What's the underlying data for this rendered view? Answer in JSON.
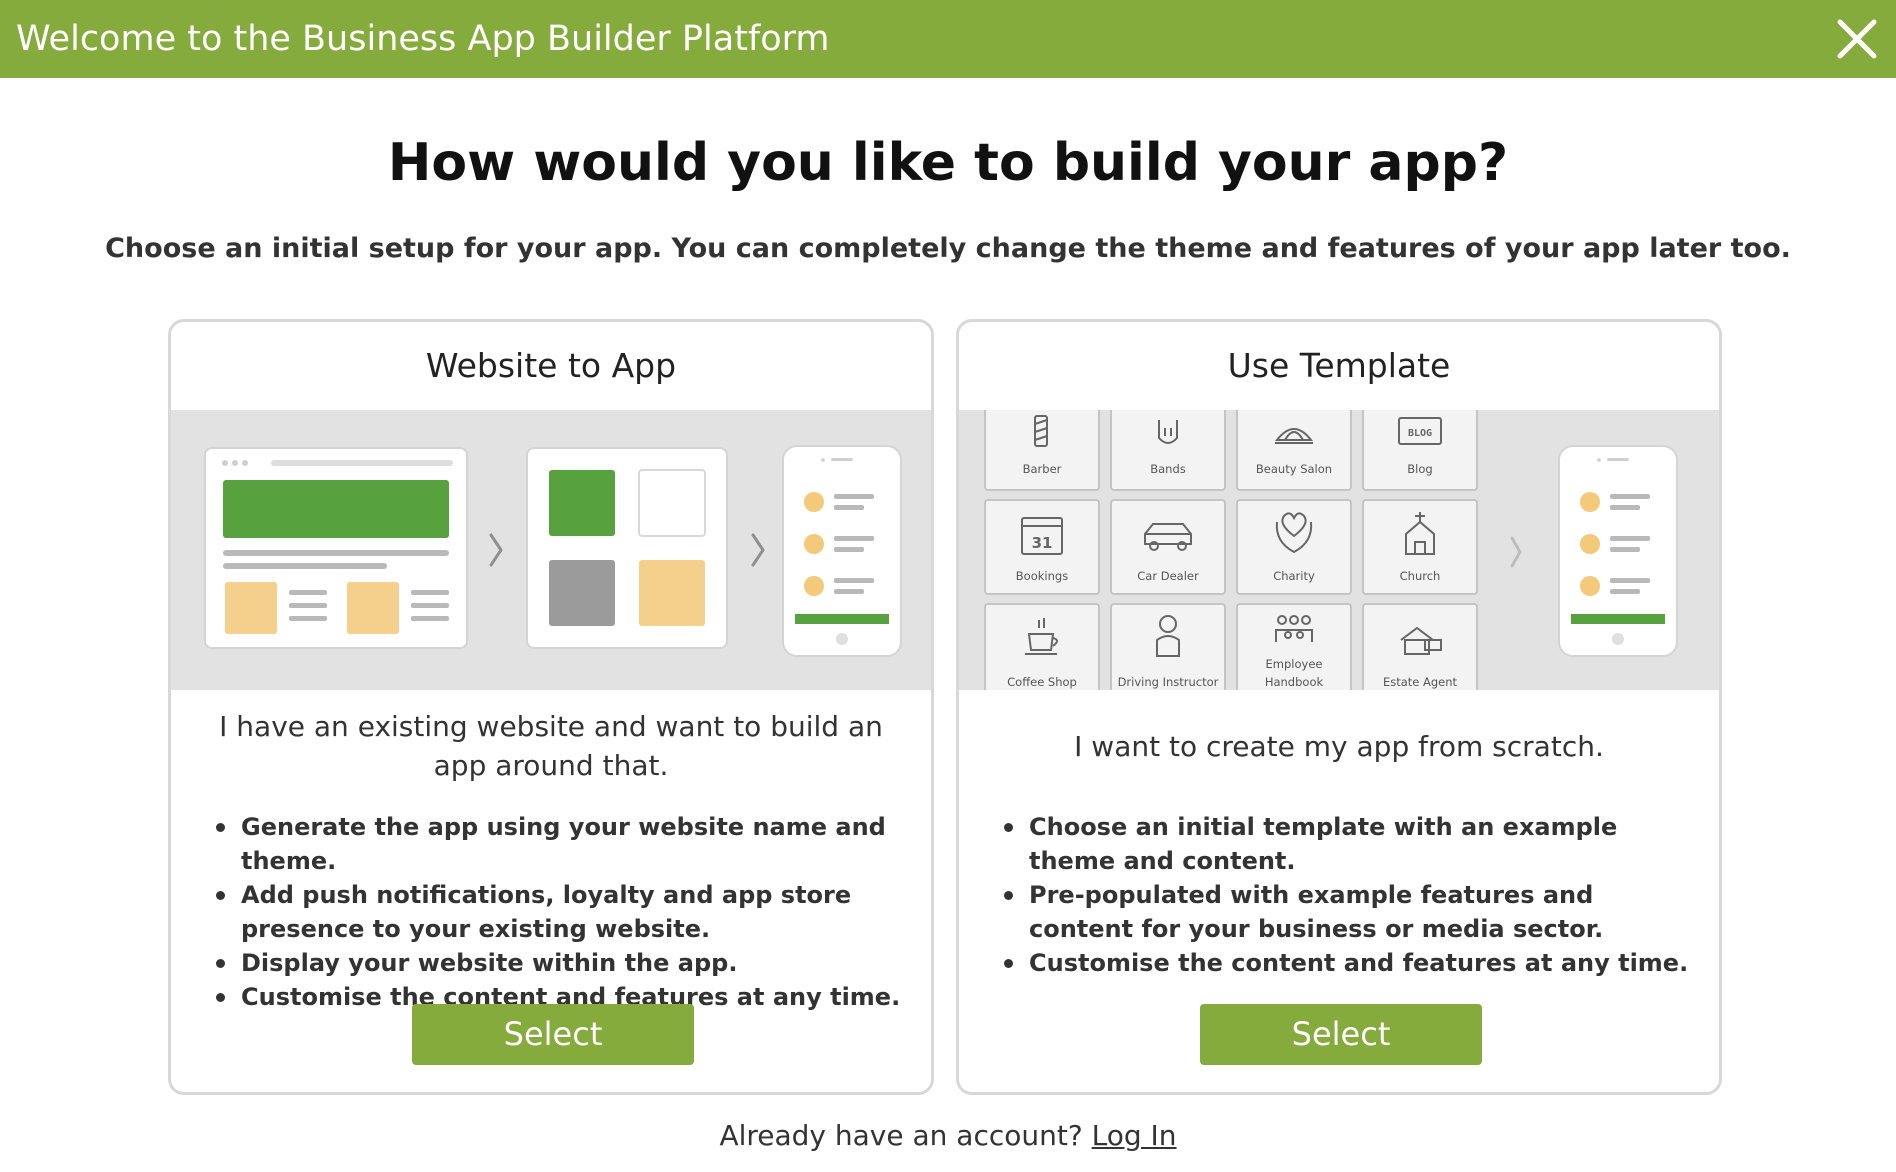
{
  "header": {
    "title": "Welcome to the Business App Builder Platform",
    "close_icon": "close-icon",
    "accent_color": "#84ab3b"
  },
  "main": {
    "title": "How would you like to build your app?",
    "subtitle": "Choose an initial setup for your app. You can completely change the theme and features of your app later too."
  },
  "cards": [
    {
      "title": "Website to App",
      "description": "I have an existing website and want to build an app around that.",
      "bullets": [
        "Generate the app using your website name and theme.",
        "Add push notifications, loyalty and app store presence to your existing website.",
        "Display your website within the app.",
        "Customise the content and features at any time."
      ],
      "button_label": "Select"
    },
    {
      "title": "Use Template",
      "description": "I want to create my app from scratch.",
      "bullets": [
        "Choose an initial template with an example theme and content.",
        "Pre-populated with example features and content for your business or media sector.",
        "Customise the content and features at any time."
      ],
      "button_label": "Select",
      "templates": {
        "barber": "Barber",
        "bands": "Bands",
        "beauty_salon": "Beauty Salon",
        "blog": "Blog",
        "blog_icon_text": "BLOG",
        "bookings": "Bookings",
        "bookings_icon_text": "31",
        "car_dealer": "Car Dealer",
        "charity": "Charity",
        "church": "Church",
        "coffee_shop": "Coffee Shop",
        "driving_instructor": "Driving Instructor",
        "employee_line1": "Employee",
        "employee_line2": "Handbook",
        "estate_agent": "Estate Agent"
      }
    }
  ],
  "footer": {
    "prompt": "Already have an account?",
    "login_label": "Log In"
  }
}
